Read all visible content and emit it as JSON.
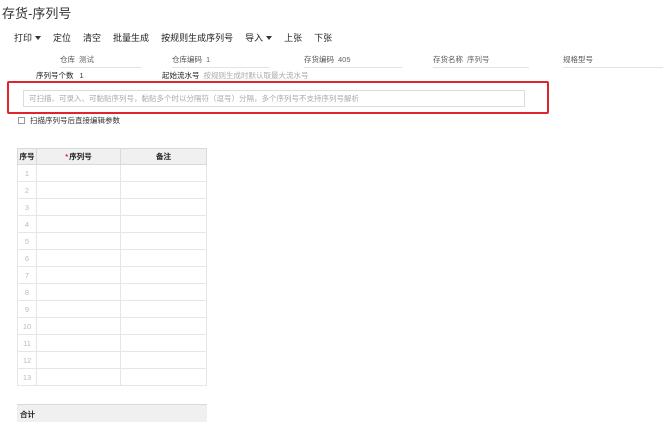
{
  "page": {
    "title": "存货-序列号"
  },
  "toolbar": {
    "items": [
      {
        "label": "打印",
        "dropdown": true
      },
      {
        "label": "定位",
        "dropdown": false
      },
      {
        "label": "清空",
        "dropdown": false
      },
      {
        "label": "批量生成",
        "dropdown": false
      },
      {
        "label": "按规则生成序列号",
        "dropdown": false
      },
      {
        "label": "导入",
        "dropdown": true
      },
      {
        "label": "上张",
        "dropdown": false
      },
      {
        "label": "下张",
        "dropdown": false
      }
    ]
  },
  "header": {
    "warehouse": {
      "label": "仓库",
      "value": "测试"
    },
    "warehouse_code": {
      "label": "仓库编码",
      "value": "1"
    },
    "inventory_code": {
      "label": "存货编码",
      "value": "405"
    },
    "inventory_name": {
      "label": "存货名称",
      "value": "序列号"
    },
    "spec_model": {
      "label": "规格型号",
      "value": ""
    }
  },
  "info": {
    "serial_count": {
      "label": "序列号个数",
      "value": "1"
    },
    "start_serial": {
      "label": "起始流水号",
      "hint": "按规则生成时默认取最大流水号"
    }
  },
  "scan": {
    "placeholder": "可扫描、可录入、可黏贴序列号，黏贴多个时以分隔符（逗号）分隔，多个序列号不支持序列号解析"
  },
  "option": {
    "label": "扫描序列号后直接编辑参数",
    "checked": false
  },
  "grid": {
    "headers": {
      "index": "序号",
      "serial": "序列号",
      "remark": "备注",
      "required_mark": "*"
    },
    "rows": [
      {
        "index": "1",
        "serial": "",
        "remark": ""
      },
      {
        "index": "2",
        "serial": "",
        "remark": ""
      },
      {
        "index": "3",
        "serial": "",
        "remark": ""
      },
      {
        "index": "4",
        "serial": "",
        "remark": ""
      },
      {
        "index": "5",
        "serial": "",
        "remark": ""
      },
      {
        "index": "6",
        "serial": "",
        "remark": ""
      },
      {
        "index": "7",
        "serial": "",
        "remark": ""
      },
      {
        "index": "8",
        "serial": "",
        "remark": ""
      },
      {
        "index": "9",
        "serial": "",
        "remark": ""
      },
      {
        "index": "10",
        "serial": "",
        "remark": ""
      },
      {
        "index": "11",
        "serial": "",
        "remark": ""
      },
      {
        "index": "12",
        "serial": "",
        "remark": ""
      },
      {
        "index": "13",
        "serial": "",
        "remark": ""
      }
    ],
    "total_label": "合计"
  },
  "colors": {
    "highlight": "#e0242b",
    "required": "#e0242b",
    "header_bg": "#f0f0f0"
  }
}
